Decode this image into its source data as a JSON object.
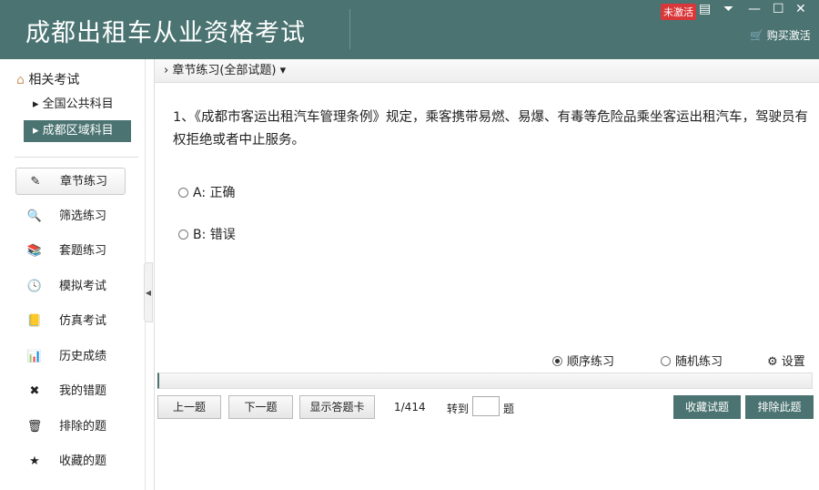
{
  "header": {
    "title": "成都出租车从业资格考试",
    "badge": "未激活",
    "buy": "购买激活"
  },
  "sidebar": {
    "section": "相关考试",
    "subs": [
      "全国公共科目",
      "成都区域科目"
    ],
    "nav": [
      {
        "label": "章节练习",
        "icon": "✎"
      },
      {
        "label": "筛选练习",
        "icon": "🔍"
      },
      {
        "label": "套题练习",
        "icon": "📚"
      },
      {
        "label": "模拟考试",
        "icon": "🕓"
      },
      {
        "label": "仿真考试",
        "icon": "📒"
      },
      {
        "label": "历史成绩",
        "icon": "📊"
      },
      {
        "label": "我的错题",
        "icon": "✖"
      },
      {
        "label": "排除的题",
        "icon": "🗑"
      },
      {
        "label": "收藏的题",
        "icon": "★"
      }
    ]
  },
  "main": {
    "breadcrumb": "章节练习(全部试题)",
    "question": "1、《成都市客运出租汽车管理条例》规定，乘客携带易燃、易爆、有毒等危险品乘坐客运出租汽车，驾驶员有权拒绝或者中止服务。",
    "options": [
      "A: 正确",
      "B: 错误"
    ],
    "mode_sequential": "顺序练习",
    "mode_random": "随机练习",
    "settings": "设置",
    "prev": "上一题",
    "next": "下一题",
    "show_card": "显示答题卡",
    "counter": "1/414",
    "goto_label": "转到",
    "goto_suffix": "题",
    "goto_value": "",
    "favorite": "收藏试题",
    "exclude": "排除此题",
    "progress": 0.0
  }
}
